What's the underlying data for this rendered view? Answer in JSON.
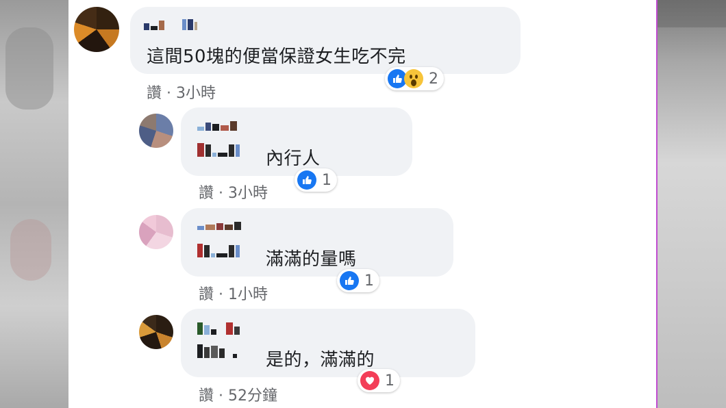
{
  "comments": [
    {
      "text": "這間50塊的便當保證女生吃不完",
      "reaction_count": "2",
      "reactions": [
        "like-icon",
        "wow-icon"
      ],
      "like_action": "讚",
      "time": "3小時"
    },
    {
      "text": "內行人",
      "reaction_count": "1",
      "reactions": [
        "like-icon"
      ],
      "like_action": "讚",
      "time": "3小時"
    },
    {
      "text": "滿滿的量嗎",
      "reaction_count": "1",
      "reactions": [
        "like-icon"
      ],
      "like_action": "讚",
      "time": "1小時"
    },
    {
      "text": "是的，滿滿的",
      "reaction_count": "1",
      "reactions": [
        "love-icon"
      ],
      "like_action": "讚",
      "time": "52分鐘"
    }
  ],
  "separator": "·",
  "colors": {
    "bubble": "#f0f2f5",
    "like": "#1877f2",
    "love": "#f33e58",
    "wow": "#f7c43a",
    "meta": "#65676b",
    "right_border": "#c04bd0"
  }
}
